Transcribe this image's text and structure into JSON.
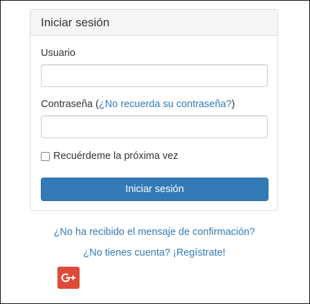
{
  "login": {
    "heading": "Iniciar sesión",
    "username_label": "Usuario",
    "username_value": "",
    "password_label_prefix": "Contraseña (",
    "forgot_password_link": "¿No recuerda su contraseña?",
    "password_label_suffix": ")",
    "password_value": "",
    "remember_label": "Recuérdeme la próxima vez",
    "remember_checked": false,
    "submit_label": "Iniciar sesión"
  },
  "footer": {
    "confirmation_link": "¿No ha recibido el mensaje de confirmación?",
    "register_link": "¿No tienes cuenta? ¡Regístrate!"
  },
  "social": {
    "google_plus_icon": "google-plus-icon",
    "google_plus_color": "#dd4b39"
  },
  "colors": {
    "primary": "#337ab7",
    "link": "#337ab7",
    "panel_heading_bg": "#f5f5f5",
    "border": "#dddddd"
  }
}
